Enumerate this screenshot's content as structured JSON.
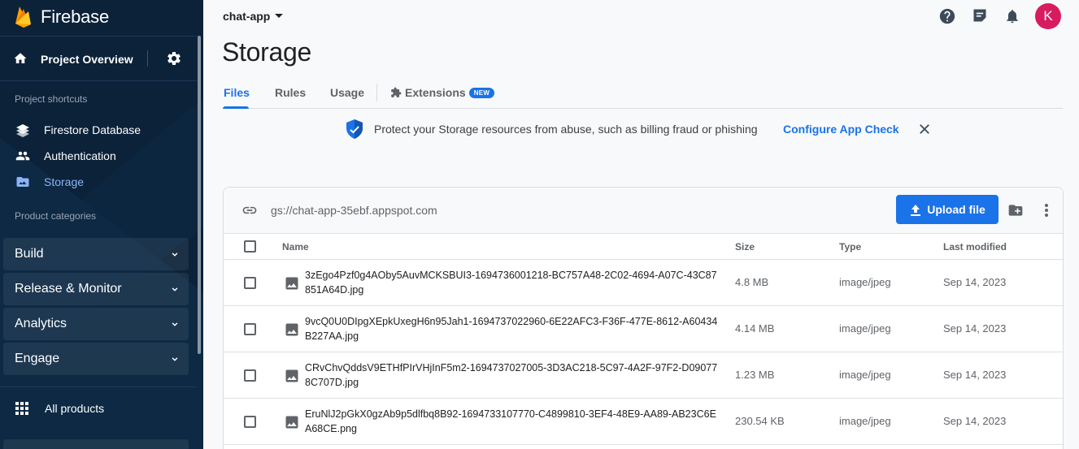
{
  "app": {
    "brand": "Firebase"
  },
  "sidebar": {
    "overview_label": "Project Overview",
    "shortcuts_title": "Project shortcuts",
    "shortcuts": [
      {
        "label": "Firestore Database",
        "icon": "firestore-icon",
        "active": false
      },
      {
        "label": "Authentication",
        "icon": "people-icon",
        "active": false
      },
      {
        "label": "Storage",
        "icon": "storage-folder-icon",
        "active": true
      }
    ],
    "categories_title": "Product categories",
    "categories": [
      {
        "label": "Build"
      },
      {
        "label": "Release & Monitor"
      },
      {
        "label": "Analytics"
      },
      {
        "label": "Engage"
      }
    ],
    "all_products_label": "All products"
  },
  "header": {
    "project_name": "chat-app",
    "avatar_initial": "K",
    "avatar_color": "#d81b60"
  },
  "page": {
    "title": "Storage"
  },
  "tabs": [
    {
      "label": "Files",
      "active": true
    },
    {
      "label": "Rules",
      "active": false
    },
    {
      "label": "Usage",
      "active": false
    },
    {
      "label": "Extensions",
      "active": false,
      "badge": "NEW"
    }
  ],
  "banner": {
    "message": "Protect your Storage resources from abuse, such as billing fraud or phishing",
    "action": "Configure App Check"
  },
  "bucket": {
    "url": "gs://chat-app-35ebf.appspot.com",
    "upload_label": "Upload file"
  },
  "table": {
    "columns": {
      "name": "Name",
      "size": "Size",
      "type": "Type",
      "modified": "Last modified"
    },
    "rows": [
      {
        "name": "3zEgo4Pzf0g4AOby5AuvMCKSBUI3-1694736001218-BC757A48-2C02-4694-A07C-43C87851A64D.jpg",
        "size": "4.8 MB",
        "type": "image/jpeg",
        "modified": "Sep 14, 2023"
      },
      {
        "name": "9vcQ0U0DIpgXEpkUxegH6n95Jah1-1694737022960-6E22AFC3-F36F-477E-8612-A60434B227AA.jpg",
        "size": "4.14 MB",
        "type": "image/jpeg",
        "modified": "Sep 14, 2023"
      },
      {
        "name": "CRvChvQddsV9ETHfPIrVHjInF5m2-1694737027005-3D3AC218-5C97-4A2F-97F2-D090778C707D.jpg",
        "size": "1.23 MB",
        "type": "image/jpeg",
        "modified": "Sep 14, 2023"
      },
      {
        "name": "EruNlJ2pGkX0gzAb9p5dlfbq8B92-1694733107770-C4899810-3EF4-48E9-AA89-AB23C6EA68CE.png",
        "size": "230.54 KB",
        "type": "image/jpeg",
        "modified": "Sep 14, 2023"
      }
    ]
  },
  "colors": {
    "accent": "#1a73e8",
    "sidebar_bg": "#0b2239",
    "active_nav": "#8ab4f8"
  }
}
